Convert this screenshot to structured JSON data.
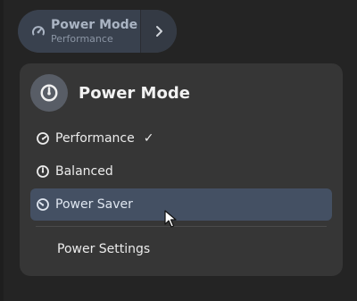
{
  "toggle": {
    "title": "Power Mode",
    "subtitle": "Performance",
    "icon": "speedometer-icon",
    "arrow_icon": "chevron-right-icon"
  },
  "menu": {
    "title": "Power Mode",
    "header_icon": "speedometer-icon",
    "items": [
      {
        "label": "Performance",
        "icon": "performance-icon",
        "selected_mark": "✓"
      },
      {
        "label": "Balanced",
        "icon": "balanced-icon"
      },
      {
        "label": "Power Saver",
        "icon": "power-saver-icon"
      }
    ],
    "settings_label": "Power Settings"
  },
  "colors": {
    "panel": "#363636",
    "hover": "#445063",
    "toggle_active": "#39414e"
  }
}
